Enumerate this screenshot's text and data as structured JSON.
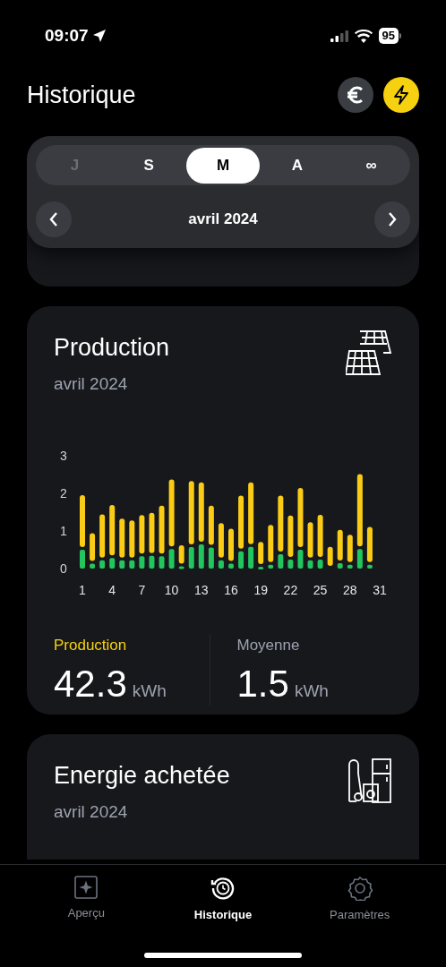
{
  "status_bar": {
    "time": "09:07",
    "battery": "95"
  },
  "header": {
    "title": "Historique"
  },
  "period_selector": {
    "tabs": [
      {
        "label": "J",
        "selected": false,
        "disabled": true
      },
      {
        "label": "S",
        "selected": false,
        "disabled": false
      },
      {
        "label": "M",
        "selected": true,
        "disabled": false
      },
      {
        "label": "A",
        "selected": false,
        "disabled": false
      },
      {
        "label": "∞",
        "selected": false,
        "disabled": false
      }
    ],
    "period": "avril 2024"
  },
  "production_card": {
    "title": "Production",
    "subtitle": "avril 2024",
    "chart_data": {
      "type": "bar",
      "stacked": true,
      "x": [
        1,
        2,
        3,
        4,
        5,
        6,
        7,
        8,
        9,
        10,
        11,
        12,
        13,
        14,
        15,
        16,
        17,
        18,
        19,
        20,
        21,
        22,
        23,
        24,
        25,
        26,
        27,
        28,
        29,
        30
      ],
      "series": [
        {
          "color": "#22c55e",
          "values": [
            0.5,
            0.13,
            0.22,
            0.28,
            0.22,
            0.22,
            0.33,
            0.34,
            0.33,
            0.52,
            0.06,
            0.57,
            0.64,
            0.56,
            0.22,
            0.13,
            0.46,
            0.58,
            0.05,
            0.1,
            0.38,
            0.24,
            0.5,
            0.22,
            0.24,
            0,
            0.14,
            0.1,
            0.52,
            0.1
          ]
        },
        {
          "color": "#facc15",
          "values": [
            1.45,
            0.81,
            1.22,
            1.41,
            1.11,
            1.06,
            1.09,
            1.14,
            1.34,
            1.85,
            0.56,
            1.76,
            1.65,
            1.11,
            0.99,
            0.93,
            1.48,
            1.71,
            0.66,
            1.06,
            1.56,
            1.17,
            1.64,
            1.01,
            1.19,
            0.58,
            0.89,
            0.8,
            1.99,
            1.01
          ]
        }
      ],
      "xlim": [
        1,
        31
      ],
      "ylim": [
        0,
        3
      ],
      "xticks": [
        1,
        4,
        7,
        10,
        13,
        16,
        19,
        22,
        25,
        28,
        31
      ],
      "yticks": [
        0,
        1,
        2,
        3
      ]
    },
    "stats": [
      {
        "label": "Production",
        "value": "42.3",
        "unit": "kWh",
        "highlight": true
      },
      {
        "label": "Moyenne",
        "value": "1.5",
        "unit": "kWh",
        "highlight": false
      }
    ]
  },
  "energy_card": {
    "title": "Energie achetée",
    "subtitle": "avril 2024"
  },
  "tab_bar": [
    {
      "label": "Aperçu",
      "selected": false,
      "kind": "overview"
    },
    {
      "label": "Historique",
      "selected": true,
      "kind": "history"
    },
    {
      "label": "Paramètres",
      "selected": false,
      "kind": "settings"
    }
  ]
}
